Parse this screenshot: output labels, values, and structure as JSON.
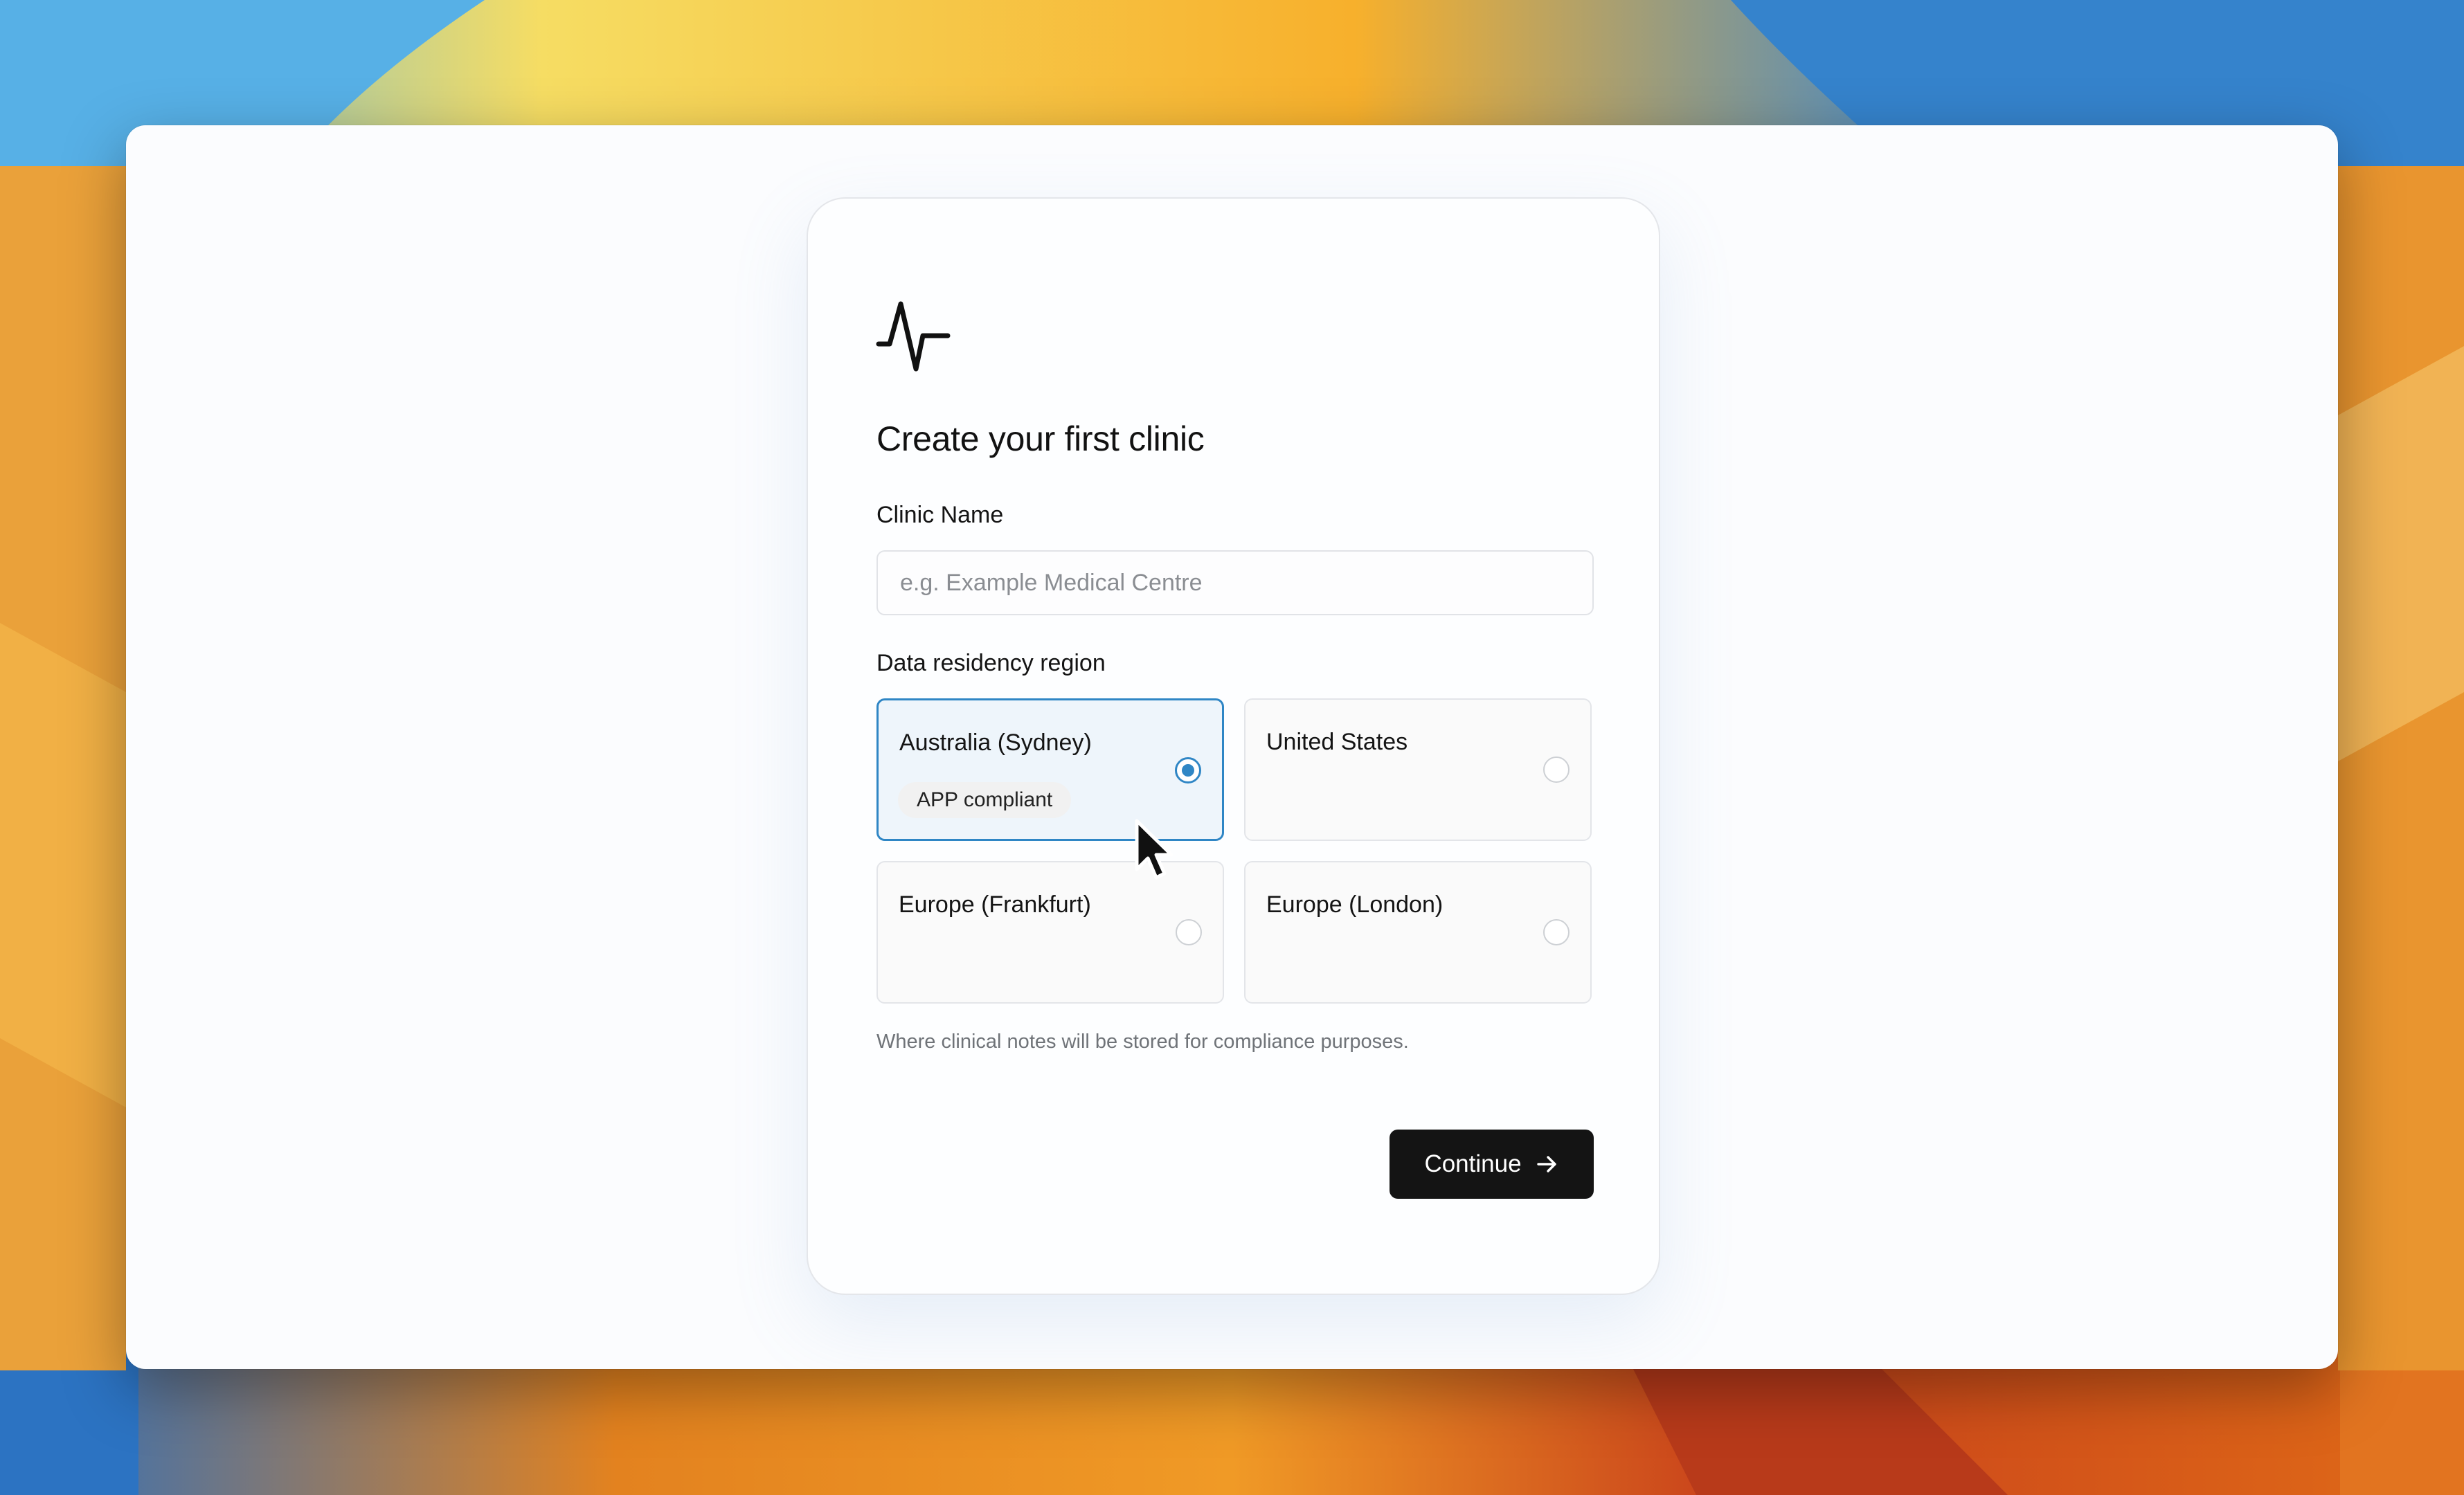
{
  "page": {
    "title": "Create your first clinic",
    "logo_icon": "pulse-icon"
  },
  "form": {
    "clinic_name": {
      "label": "Clinic Name",
      "value": "",
      "placeholder": "e.g. Example Medical Centre"
    },
    "region": {
      "label": "Data residency region",
      "selected": "Australia (Sydney)",
      "options": [
        {
          "label": "Australia (Sydney)",
          "badge": "APP compliant",
          "selected": true
        },
        {
          "label": "United States",
          "selected": false
        },
        {
          "label": "Europe (Frankfurt)",
          "selected": false
        },
        {
          "label": "Europe (London)",
          "selected": false
        }
      ],
      "help_text": "Where clinical notes will be stored for compliance purposes."
    },
    "continue_label": "Continue"
  },
  "colors": {
    "accent": "#2f86c5",
    "button_bg": "#141414",
    "selected_bg": "#eef5fb"
  }
}
